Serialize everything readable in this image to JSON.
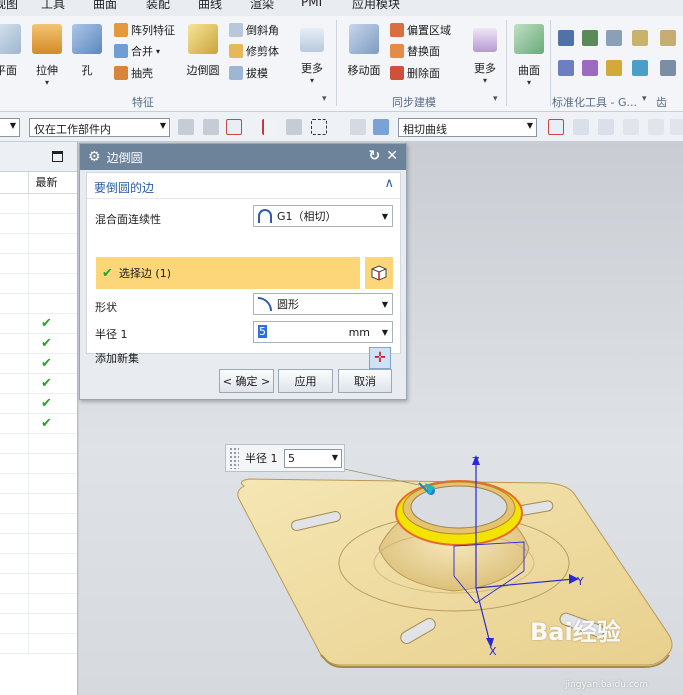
{
  "menubar": {
    "items": [
      "视图",
      "工具",
      "曲面",
      "装配",
      "曲线",
      "渲染",
      "PMI",
      "应用模块"
    ]
  },
  "ribbon": {
    "big_buttons": [
      "平面",
      "拉伸",
      "孔",
      "边倒圆",
      "更多",
      "移动面",
      "更多",
      "曲面"
    ],
    "small_buttons": {
      "feature": [
        "阵列特征",
        "合并",
        "抽壳"
      ],
      "chamfer": [
        "倒斜角",
        "修剪体",
        "拔模"
      ],
      "sync": [
        "偏置区域",
        "替换面",
        "删除面"
      ]
    },
    "groups": [
      "特征",
      "同步建模",
      "标准化工具 - G...",
      "齿轮..."
    ]
  },
  "selbar": {
    "scope": "仅在工作部件内",
    "curve_rule": "相切曲线"
  },
  "navigator": {
    "column_header": "最新",
    "rows": [
      {
        "latest": ""
      },
      {
        "latest": ""
      },
      {
        "latest": ""
      },
      {
        "latest": ""
      },
      {
        "latest": ""
      },
      {
        "latest": ""
      },
      {
        "latest": "✔"
      },
      {
        "latest": "✔"
      },
      {
        "latest": "✔"
      },
      {
        "latest": "✔"
      },
      {
        "latest": "✔"
      },
      {
        "latest": "✔"
      },
      {
        "latest": ""
      },
      {
        "latest": ""
      },
      {
        "latest": ""
      },
      {
        "latest": ""
      },
      {
        "latest": ""
      },
      {
        "latest": ""
      },
      {
        "latest": ""
      },
      {
        "latest": ""
      },
      {
        "latest": ""
      },
      {
        "latest": ""
      },
      {
        "latest": ""
      }
    ]
  },
  "dialog": {
    "title": "边倒圆",
    "section_title": "要倒圆的边",
    "continuity_label": "混合面连续性",
    "continuity_value": "G1（相切）",
    "select_edge_label": "选择边 (1)",
    "shape_label": "形状",
    "shape_value": "圆形",
    "radius_label": "半径 1",
    "radius_value": "5",
    "radius_unit": "mm",
    "add_set_label": "添加新集",
    "ok_label": "< 确定 >",
    "apply_label": "应用",
    "cancel_label": "取消"
  },
  "onscreen_input": {
    "label": "半径 1",
    "value": "5"
  },
  "axes": {
    "x": "X",
    "y": "Y",
    "z": "Z"
  },
  "watermark": {
    "brand": "Bai经验",
    "url": "jingyan.baidu.com"
  },
  "colors": {
    "dialog_title": "#6d8399",
    "selection_highlight": "#fdd67a",
    "part": "#f2dfa2",
    "fillet_edge": "#f2e400"
  }
}
